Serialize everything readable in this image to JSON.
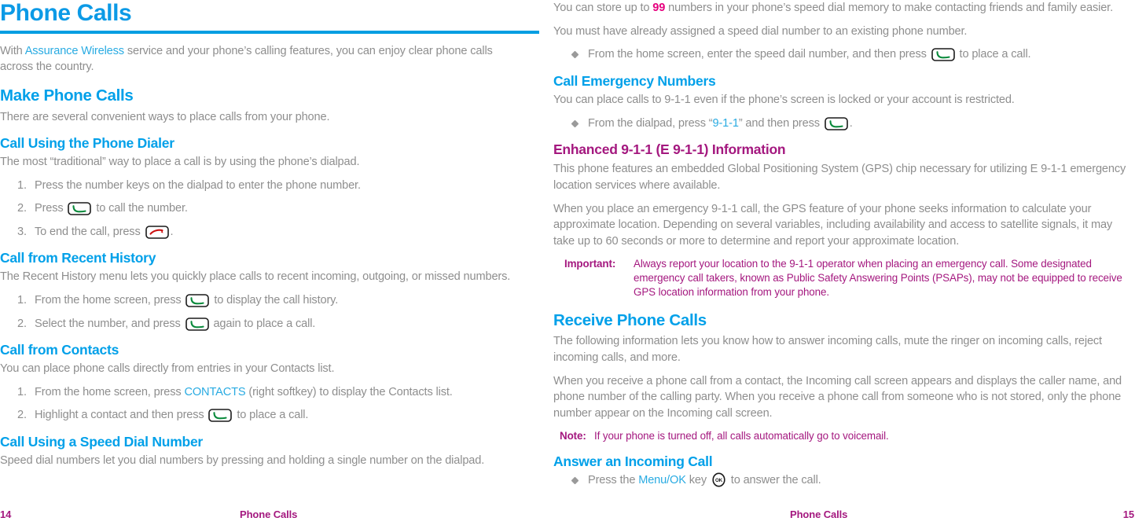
{
  "colors": {
    "heading_blue": "#00a0e9",
    "rule_blue": "#009ee2",
    "body_gray": "#8e8e8e",
    "magenta": "#a4187f",
    "accent_magenta": "#e6007e",
    "accent_blue": "#29abe2",
    "key_green": "#0a8a3c",
    "key_red": "#cc1111"
  },
  "left": {
    "title": "Phone Calls",
    "intro": {
      "pre": "With ",
      "link": "Assurance Wireless",
      "post": " service and your phone’s calling features, you can enjoy clear phone calls across the country."
    },
    "make_calls": {
      "heading": "Make Phone Calls",
      "body": "There are several convenient ways to place calls from your phone."
    },
    "dialer": {
      "heading": "Call Using the Phone Dialer",
      "body": "The most “traditional” way to place a call is by using the phone’s dialpad.",
      "steps": [
        {
          "pre": "Press the number keys on the dialpad to enter the phone number.",
          "icon": "",
          "post": ""
        },
        {
          "pre": "Press ",
          "icon": "send-key",
          "post": " to call the number."
        },
        {
          "pre": "To end the call, press ",
          "icon": "end-key",
          "post": "."
        }
      ]
    },
    "recent": {
      "heading": "Call from Recent History",
      "body": "The Recent History menu lets you quickly place calls to recent incoming, outgoing, or missed numbers.",
      "steps": [
        {
          "pre": "From the home screen, press ",
          "icon": "send-key",
          "post": " to display the call history."
        },
        {
          "pre": "Select the number, and press ",
          "icon": "send-key",
          "post": " again to place a call."
        }
      ]
    },
    "contacts": {
      "heading": "Call from Contacts",
      "body": "You can place phone calls directly from entries in your Contacts list.",
      "step1_pre": "From the home screen, press ",
      "step1_link": "CONTACTS",
      "step1_post": " (right softkey) to display the Contacts list.",
      "step2_pre": "Highlight a contact and then press ",
      "step2_post": " to place a call."
    },
    "speed_dial": {
      "heading": "Call Using a Speed Dial Number",
      "body": "Speed dial numbers let you dial numbers by pressing and holding a single number on the dialpad."
    },
    "footer": {
      "page": "14",
      "title": "Phone Calls"
    }
  },
  "right": {
    "speed_dial_cont": {
      "p1_pre": "You can store up to ",
      "p1_num": "99",
      "p1_post": " numbers in your phone’s speed dial memory to make contacting friends and family easier.",
      "p2": "You must have already assigned a speed dial number to an existing phone number.",
      "bullet_pre": "From the home screen, enter the speed dail number, and then press ",
      "bullet_post": " to place a call."
    },
    "emergency": {
      "heading": "Call Emergency Numbers",
      "body": "You can place calls to 9-1-1 even if the phone’s screen is locked or your account is restricted.",
      "bullet_pre": "From the dialpad, press “",
      "bullet_link": "9-1-1",
      "bullet_mid": "” and then press ",
      "bullet_post": "."
    },
    "e911": {
      "heading": "Enhanced 9-1-1 (E 9-1-1) Information",
      "p1": "This phone features an embedded Global Positioning System (GPS) chip necessary for utilizing E 9-1-1 emergency location services where available.",
      "p2": "When you place an emergency 9-1-1 call, the GPS feature of your phone seeks information to calculate your approximate location. Depending on several variables, including availability and access to satellite signals, it may take up to 60 seconds or more to determine and report your approximate location.",
      "important_label": "Important:",
      "important_text": "Always report your location to the 9-1-1 operator when placing an emergency call. Some designated emergency call takers, known as Public Safety Answering Points (PSAPs), may not be equipped to receive GPS location information from your phone."
    },
    "receive": {
      "heading": "Receive Phone Calls",
      "p1": "The following information lets you know how to answer incoming calls, mute the ringer on incoming calls, reject incoming calls, and more.",
      "p2": "When you receive a phone call from a contact, the Incoming call screen appears and displays the caller name, and phone number of the calling party. When you receive a phone call from someone who is not stored, only the phone number appear on the Incoming call screen.",
      "note_label": "Note:",
      "note_text": "If your phone is turned off, all calls automatically go to voicemail."
    },
    "answer": {
      "heading": "Answer an Incoming Call",
      "bullet_pre": "Press the ",
      "bullet_link": "Menu/OK",
      "bullet_mid": " key ",
      "bullet_post": " to answer the call."
    },
    "footer": {
      "page": "15",
      "title": "Phone Calls"
    }
  }
}
